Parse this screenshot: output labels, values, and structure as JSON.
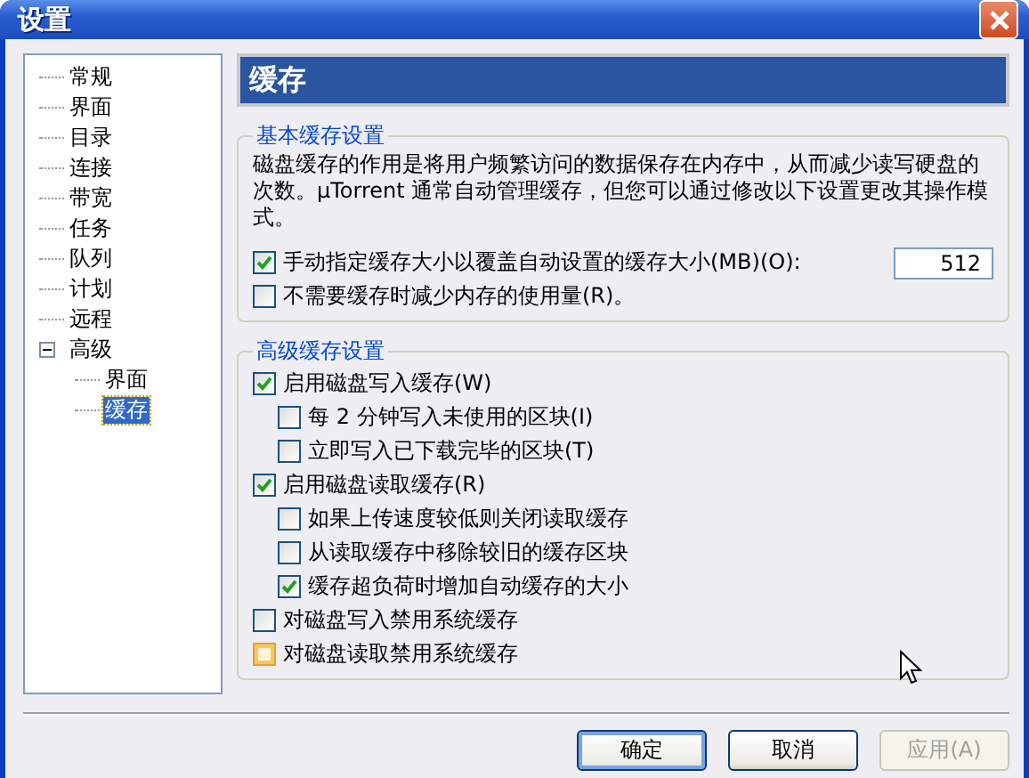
{
  "window": {
    "title": "设置"
  },
  "sidebar": {
    "items": [
      {
        "label": "常规",
        "selected": false
      },
      {
        "label": "界面",
        "selected": false
      },
      {
        "label": "目录",
        "selected": false
      },
      {
        "label": "连接",
        "selected": false
      },
      {
        "label": "带宽",
        "selected": false
      },
      {
        "label": "任务",
        "selected": false
      },
      {
        "label": "队列",
        "selected": false
      },
      {
        "label": "计划",
        "selected": false
      },
      {
        "label": "远程",
        "selected": false
      },
      {
        "label": "高级",
        "selected": false,
        "expanded": true,
        "children": [
          {
            "label": "界面",
            "selected": false
          },
          {
            "label": "缓存",
            "selected": true
          }
        ]
      }
    ]
  },
  "page_title": "缓存",
  "basic_group": {
    "title": "基本缓存设置",
    "description": "磁盘缓存的作用是将用户频繁访问的数据保存在内存中，从而减少读写硬盘的次数。µTorrent 通常自动管理缓存，但您可以通过修改以下设置更改其操作模式。",
    "options": [
      {
        "label": "手动指定缓存大小以覆盖自动设置的缓存大小(MB)(O):",
        "checked": true,
        "value": "512"
      },
      {
        "label": "不需要缓存时减少内存的使用量(R)。",
        "checked": false
      }
    ]
  },
  "advanced_group": {
    "title": "高级缓存设置",
    "options": [
      {
        "label": "启用磁盘写入缓存(W)",
        "checked": true,
        "children": [
          {
            "label": "每 2 分钟写入未使用的区块(I)",
            "checked": false
          },
          {
            "label": "立即写入已下载完毕的区块(T)",
            "checked": false
          }
        ]
      },
      {
        "label": "启用磁盘读取缓存(R)",
        "checked": true,
        "children": [
          {
            "label": "如果上传速度较低则关闭读取缓存",
            "checked": false
          },
          {
            "label": "从读取缓存中移除较旧的缓存区块",
            "checked": false
          },
          {
            "label": "缓存超负荷时增加自动缓存的大小",
            "checked": true
          }
        ]
      },
      {
        "label": "对磁盘写入禁用系统缓存",
        "checked": false
      },
      {
        "label": "对磁盘读取禁用系统缓存",
        "checked": false,
        "hovered": true
      }
    ]
  },
  "buttons": [
    {
      "label": "确定",
      "disabled": false,
      "default": true
    },
    {
      "label": "取消",
      "disabled": false,
      "default": false
    },
    {
      "label": "应用(A)",
      "disabled": true,
      "default": false
    }
  ]
}
